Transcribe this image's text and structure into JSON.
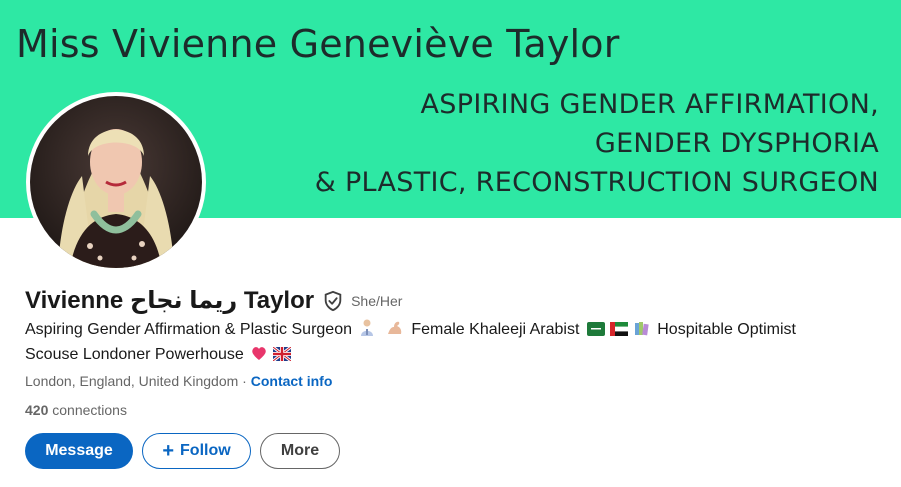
{
  "banner": {
    "name": "Miss Vivienne Geneviève Taylor",
    "tagline_lines": [
      "ASPIRING GENDER AFFIRMATION,",
      "GENDER DYSPHORIA",
      "& PLASTIC, RECONSTRUCTION SURGEON"
    ],
    "background_color": "#2ee8a4"
  },
  "profile": {
    "name": "Vivienne ريما نجاح Taylor",
    "verified_icon": "shield-check-icon",
    "pronouns": "She/Her",
    "headline_line1": "Aspiring Gender Affirmation & Plastic Surgeon",
    "headline_mid": "Female Khaleeji Arabist",
    "headline_end": "Hospitable Optimist",
    "headline_line2": "Scouse Londoner Powerhouse",
    "headline_emoji": [
      "doctor-emoji",
      "flexed-biceps-emoji",
      "flag-saudi-arabia-emoji",
      "flag-uae-emoji",
      "books-emoji",
      "heart-emoji",
      "flag-uk-emoji"
    ],
    "location": "London, England, United Kingdom",
    "separator": "·",
    "contact_label": "Contact info",
    "connections_count": "420",
    "connections_label": "connections"
  },
  "actions": {
    "message_label": "Message",
    "follow_label": "Follow",
    "more_label": "More"
  },
  "colors": {
    "accent": "#0a66c2",
    "muted_text": "#666666",
    "primary_text": "#191919"
  }
}
